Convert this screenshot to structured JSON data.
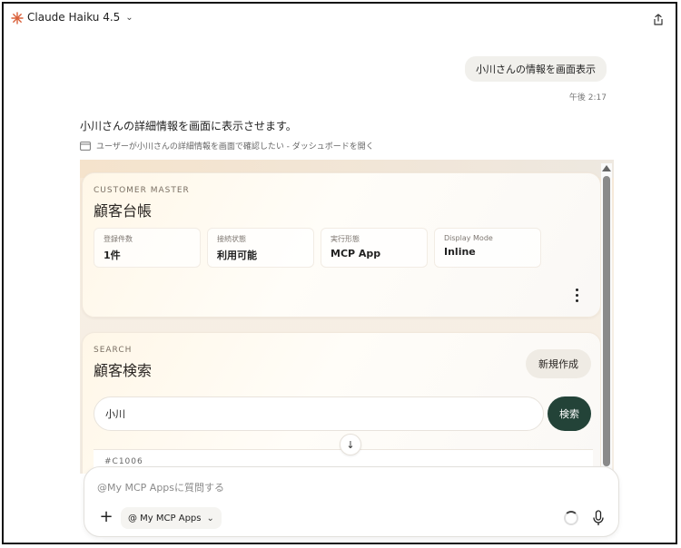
{
  "header": {
    "model_name": "Claude Haiku 4.5",
    "logo_icon": "claude-sunburst-icon",
    "share_icon": "share-icon"
  },
  "conversation": {
    "user_message": "小川さんの情報を画面表示",
    "user_timestamp": "午後 2:17",
    "assistant_message": "小川さんの詳細情報を画面に表示させます。",
    "tool_call_label": "ユーザーが小川さんの詳細情報を画面で確認したい - ダッシュボードを開く"
  },
  "app": {
    "master": {
      "eyebrow": "CUSTOMER MASTER",
      "title": "顧客台帳",
      "stats": [
        {
          "label": "登録件数",
          "value": "1件"
        },
        {
          "label": "接続状態",
          "value": "利用可能"
        },
        {
          "label": "実行形態",
          "value": "MCP App"
        },
        {
          "label": "Display Mode",
          "value": "Inline"
        }
      ]
    },
    "search": {
      "eyebrow": "SEARCH",
      "title": "顧客検索",
      "new_button": "新規作成",
      "query": "小川",
      "search_button": "検索",
      "result_id": "#C1006"
    },
    "scroll_down_glyph": "↓"
  },
  "composer": {
    "placeholder": "@My MCP Appsに質問する",
    "apps_chip": "@ My MCP Apps",
    "plus_glyph": "+"
  },
  "colors": {
    "accent_dark_green": "#234338",
    "logo_orange": "#d9603a"
  }
}
